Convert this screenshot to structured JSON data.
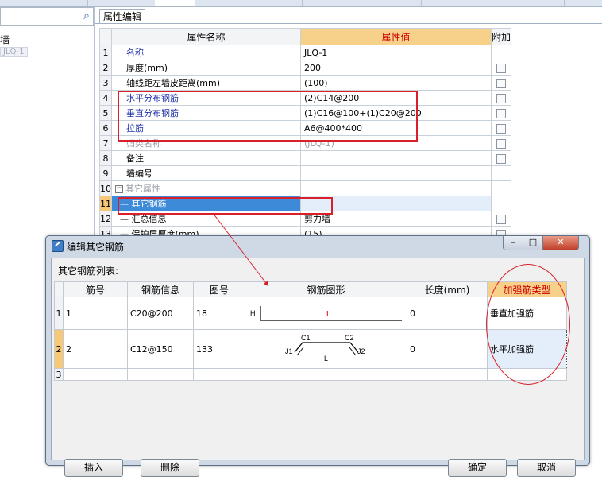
{
  "app": {
    "left_tree_item": "墙",
    "left_tree_sub": "JLQ-1"
  },
  "prop_panel": {
    "tab": "属性编辑",
    "columns": [
      "属性名称",
      "属性值",
      "附加"
    ],
    "rows": [
      {
        "n": "1",
        "name": "名称",
        "value": "JLQ-1",
        "style": "blue",
        "check": false
      },
      {
        "n": "2",
        "name": "厚度(mm)",
        "value": "200",
        "style": "",
        "check": true
      },
      {
        "n": "3",
        "name": "轴线距左墙皮距离(mm)",
        "value": "(100)",
        "style": "",
        "check": true
      },
      {
        "n": "4",
        "name": "水平分布钢筋",
        "value": "(2)C14@200",
        "style": "blue",
        "check": true
      },
      {
        "n": "5",
        "name": "垂直分布钢筋",
        "value": "(1)C16@100+(1)C20@200",
        "style": "blue",
        "check": true
      },
      {
        "n": "6",
        "name": "拉筋",
        "value": "A6@400*400",
        "style": "blue",
        "check": true
      },
      {
        "n": "7",
        "name": "归类名称",
        "value": "(JLQ-1)",
        "style": "gray",
        "check": true
      },
      {
        "n": "8",
        "name": "备注",
        "value": "",
        "style": "",
        "check": true
      },
      {
        "n": "9",
        "name": "墙编号",
        "value": "",
        "style": "",
        "check": false
      },
      {
        "n": "10",
        "name": "其它属性",
        "value": "",
        "style": "gray",
        "check": false
      },
      {
        "n": "11",
        "name": "其它钢筋",
        "value": "",
        "style": "sel",
        "check": false
      },
      {
        "n": "12",
        "name": "汇总信息",
        "value": "剪力墙",
        "style": "",
        "check": true
      },
      {
        "n": "13",
        "name": "保护层厚度(mm)",
        "value": "(15)",
        "style": "",
        "check": true
      }
    ]
  },
  "dialog": {
    "title": "编辑其它钢筋",
    "list_label": "其它钢筋列表:",
    "columns": [
      "筋号",
      "钢筋信息",
      "图号",
      "钢筋图形",
      "长度(mm)",
      "加强筋类型"
    ],
    "rows": [
      {
        "n": "1",
        "bar_no": "1",
        "info": "C20@200",
        "fig_no": "18",
        "length": "0",
        "type": "垂直加强筋"
      },
      {
        "n": "2",
        "bar_no": "2",
        "info": "C12@150",
        "fig_no": "133",
        "length": "0",
        "type": "水平加强筋"
      },
      {
        "n": "3",
        "bar_no": "",
        "info": "",
        "fig_no": "",
        "length": "",
        "type": ""
      }
    ],
    "shape1": {
      "h": "H",
      "l": "L"
    },
    "shape2": {
      "c1": "C1",
      "c2": "C2",
      "j1": "J1",
      "j2": "J2",
      "l": "L"
    },
    "buttons": {
      "insert": "插入",
      "delete": "删除",
      "ok": "确定",
      "cancel": "取消"
    }
  }
}
